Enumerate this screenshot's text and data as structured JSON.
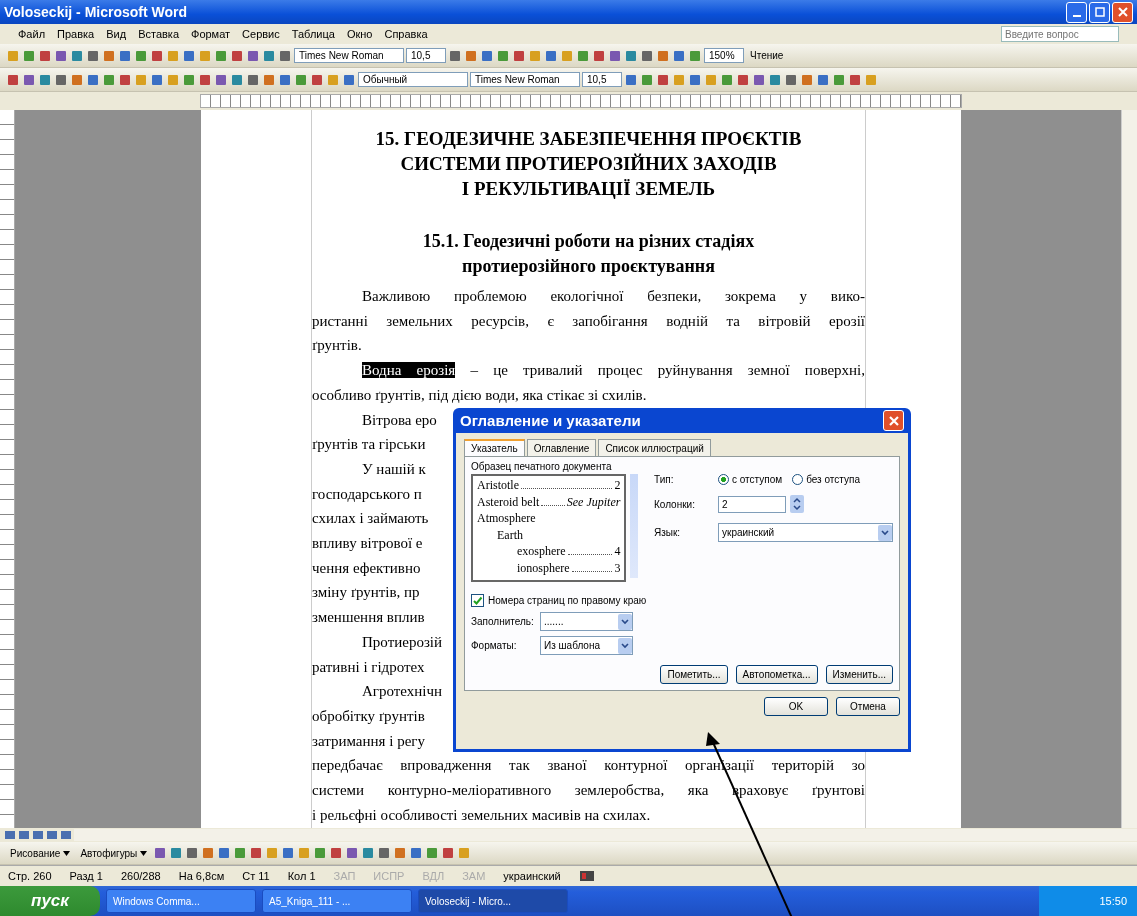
{
  "window": {
    "title": "Voloseckij - Microsoft Word"
  },
  "menu": [
    "Файл",
    "Правка",
    "Вид",
    "Вставка",
    "Формат",
    "Сервис",
    "Таблица",
    "Окно",
    "Справка"
  ],
  "help_box": {
    "placeholder": "Введите вопрос"
  },
  "standard_toolbar": {
    "font": "Times New Roman",
    "size": "10,5",
    "zoom": "150%",
    "reading_button": "Чтение"
  },
  "formatting_toolbar": {
    "style": "Обычный",
    "font": "Times New Roman",
    "size": "10,5"
  },
  "document": {
    "headings": [
      "15. ГЕОДЕЗИЧНЕ ЗАБЕЗПЕЧЕННЯ ПРОЄКТІВ",
      "СИСТЕМИ ПРОТИЕРОЗІЙНИХ ЗАХОДІВ",
      "І РЕКУЛЬТИВАЦІЇ ЗЕМЕЛЬ"
    ],
    "subheadings": [
      "15.1. Геодезичні роботи на різних стадіях",
      "протиерозійного проєктування"
    ],
    "lines": [
      {
        "text": "Важливою проблемою екологічної безпеки, зокрема у вико-",
        "indent": true,
        "justify": true
      },
      {
        "text": "ристанні земельних ресурсів, є запобігання водній та вітровій ерозії",
        "indent": false,
        "justify": true
      },
      {
        "text": "ґрунтів.",
        "indent": false,
        "justify": false
      },
      {
        "selected_text": "Водна ерозія",
        "text": " – це тривалий процес руйнування земної поверхні,",
        "indent": true,
        "justify": true
      },
      {
        "text": "особливо ґрунтів, під дією води, яка стікає зі схилів.",
        "indent": false,
        "justify": false
      }
    ],
    "covered_lines": [
      {
        "text": "Вітрова еро",
        "indent": true
      },
      {
        "text": "ґрунтів та гірськи",
        "indent": false
      },
      {
        "text": "У нашій к",
        "indent": true
      },
      {
        "text": "господарського п",
        "indent": false
      },
      {
        "text": "схилах і займають",
        "indent": false
      },
      {
        "text": "впливу вітрової е",
        "indent": false
      },
      {
        "text": "чення ефективно",
        "indent": false
      },
      {
        "text": "зміну ґрунтів, пр",
        "indent": false
      },
      {
        "text": "зменшення вплив",
        "indent": false
      },
      {
        "text": "Протиерозій",
        "indent": true
      },
      {
        "text": "ративні і гідротех",
        "indent": false
      },
      {
        "text": "Агротехнічн",
        "indent": true
      },
      {
        "text": "обробітку ґрунтів",
        "indent": false
      },
      {
        "text": "затримання і регу",
        "indent": false
      }
    ],
    "end_lines": [
      {
        "text": "передбачає впровадження так званої контурної організації територій зо",
        "indent": false,
        "justify": true
      },
      {
        "text": "системи контурно-меліоративного землеробства, яка враховує ґрунтові",
        "indent": false,
        "justify": true
      },
      {
        "text": "і рельєфні особливості земельних масивів на схилах.",
        "indent": false,
        "justify": false
      }
    ]
  },
  "dialog": {
    "title": "Оглавление и указатели",
    "tabs": [
      {
        "label": "Указатель",
        "selected": true
      },
      {
        "label": "Оглавление",
        "selected": false
      },
      {
        "label": "Список иллюстраций",
        "selected": false
      }
    ],
    "preview_label": "Образец печатного документа",
    "preview": [
      {
        "term": "Aristotle",
        "kind": "page",
        "ref": "2"
      },
      {
        "term": "Asteroid belt",
        "kind": "see",
        "ref": "See Jupiter"
      },
      {
        "term": "Atmosphere",
        "children": [
          {
            "term": "Earth",
            "children": [
              {
                "term": "exosphere",
                "kind": "page",
                "ref": "4"
              },
              {
                "term": "ionosphere",
                "kind": "page",
                "ref": "3"
              }
            ]
          }
        ]
      }
    ],
    "type_label": "Тип:",
    "type_options": [
      {
        "label": "с отступом",
        "selected": true
      },
      {
        "label": "без отступа",
        "selected": false
      }
    ],
    "columns_label": "Колонки:",
    "columns_value": "2",
    "language_label": "Язык:",
    "language_value": "украинский",
    "right_align": {
      "label": "Номера страниц по правому краю",
      "checked": true
    },
    "leader_label": "Заполнитель:",
    "leader_value": ".......",
    "formats_label": "Форматы:",
    "formats_value": "Из шаблона",
    "buttons": [
      "Пометить...",
      "Автопометка...",
      "Изменить..."
    ],
    "ok": "OK",
    "cancel": "Отмена"
  },
  "drawing_toolbar": {
    "draw_menu": "Рисование",
    "autoshapes_menu": "Автофигуры"
  },
  "status_bar": [
    "Стр. 260",
    "Разд 1",
    "260/288",
    "На 6,8см",
    "Ст 11",
    "Кол 1"
  ],
  "status_modes": [
    {
      "label": "ЗАП",
      "on": false
    },
    {
      "label": "ИСПР",
      "on": false
    },
    {
      "label": "ВДЛ",
      "on": false
    },
    {
      "label": "ЗАМ",
      "on": false
    }
  ],
  "status_language": "украинский",
  "taskbar": {
    "start": "пуск",
    "tasks": [
      {
        "label": "Windows Comma...",
        "selected": false
      },
      {
        "label": "A5_Kniga_111 - ...",
        "selected": false
      },
      {
        "label": "Voloseckij - Micro...",
        "selected": true
      }
    ],
    "clock": "15:50"
  }
}
